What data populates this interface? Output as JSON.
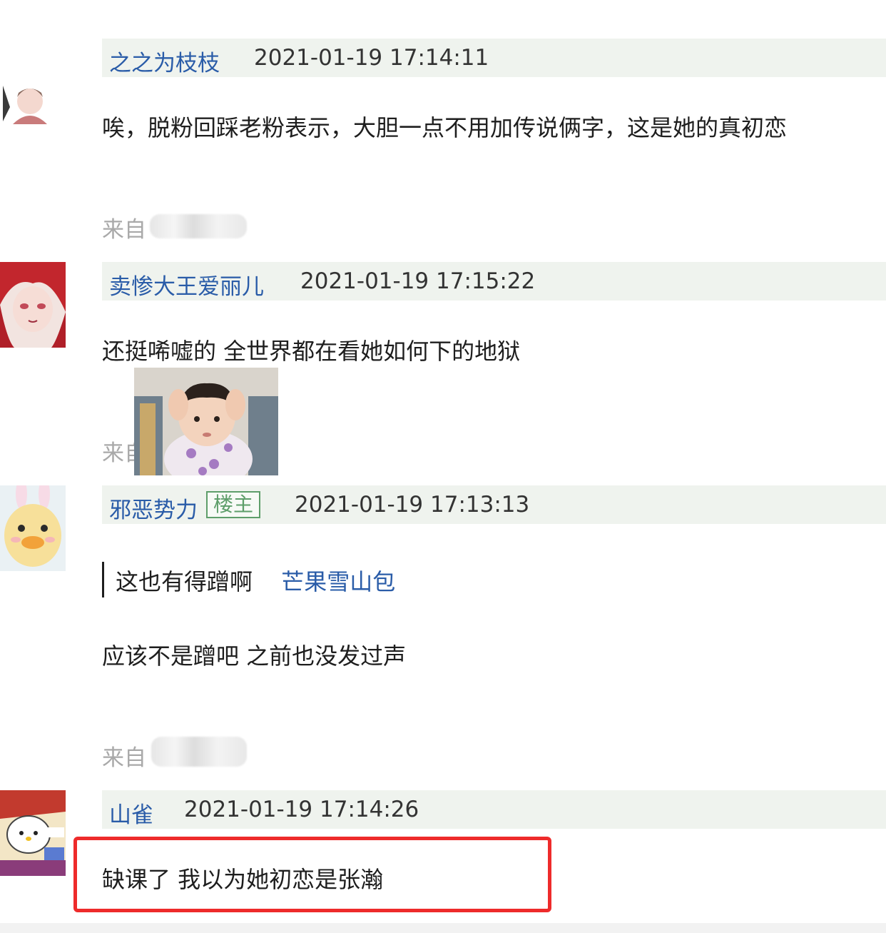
{
  "comments": [
    {
      "username": "之之为枝枝",
      "timestamp": "2021-01-19 17:14:11",
      "text": "唉，脱粉回踩老粉表示，大胆一点不用加传说俩字，这是她的真初恋",
      "from_label": "来自"
    },
    {
      "username": "卖惨大王爱丽儿",
      "timestamp": "2021-01-19 17:15:22",
      "text": "还挺唏嘘的 全世界都在看她如何下的地狱",
      "from_label": "来自"
    },
    {
      "username": "邪恶势力",
      "badge": "楼主",
      "timestamp": "2021-01-19 17:13:13",
      "quote_text": "这也有得蹭啊",
      "quote_author": "芒果雪山包",
      "text": "应该不是蹭吧 之前也没发过声",
      "from_label": "来自"
    },
    {
      "username": "山雀",
      "timestamp": "2021-01-19 17:14:26",
      "text": "缺课了 我以为她初恋是张瀚"
    }
  ],
  "colors": {
    "username": "#2a5ca8",
    "header_bg": "#eff3ee",
    "owner_badge": "#5e9e6a",
    "highlight": "#ee2b2b"
  }
}
